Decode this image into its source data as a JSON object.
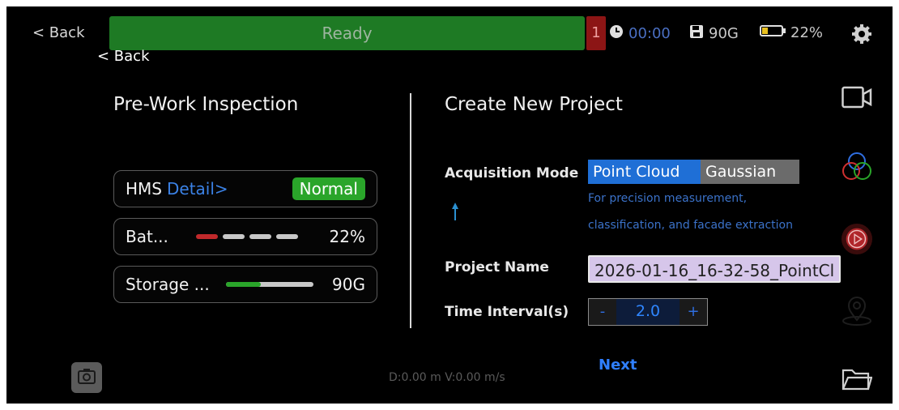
{
  "topbar": {
    "back_label": "< Back",
    "sub_back_label": "< Back",
    "status": "Ready",
    "alert_count": "1",
    "timer": "00:00",
    "storage": "90G",
    "battery": "22%"
  },
  "inspection": {
    "title": "Pre-Work Inspection",
    "hms_label": "HMS",
    "hms_link": "Detail>",
    "hms_status": "Normal",
    "battery_label": "Bat...",
    "battery_value": "22%",
    "battery_level": 0.25,
    "storage_label": "Storage ...",
    "storage_value": "90G",
    "storage_used_fraction": 0.4
  },
  "project": {
    "title": "Create New Project",
    "acq_label": "Acquisition Mode",
    "mode_point_cloud": "Point Cloud",
    "mode_gaussian": "Gaussian",
    "hint_line1": "For precision measurement,",
    "hint_line2": "classification, and facade extraction",
    "name_label": "Project Name",
    "name_value": "2026-01-16_16-32-58_PointCl",
    "interval_label": "Time Interval(s)",
    "interval_minus": "-",
    "interval_value": "2.0",
    "interval_plus": "+",
    "next_label": "Next"
  },
  "readout": "D:0.00 m V:0.00 m/s",
  "colors": {
    "accent_blue": "#2f7fff",
    "status_green": "#1e7a24",
    "normal_green": "#2aa52a",
    "alert_red": "#8c1515",
    "record_red": "#c0392b",
    "selected_mode": "#1f6fd6",
    "unselected_mode": "#6b6b6b"
  },
  "icons": [
    "clock-icon",
    "save-icon",
    "battery-icon",
    "gear-icon",
    "camera-icon",
    "layers-icon",
    "play-icon",
    "location-icon",
    "folder-icon",
    "snapshot-icon"
  ]
}
